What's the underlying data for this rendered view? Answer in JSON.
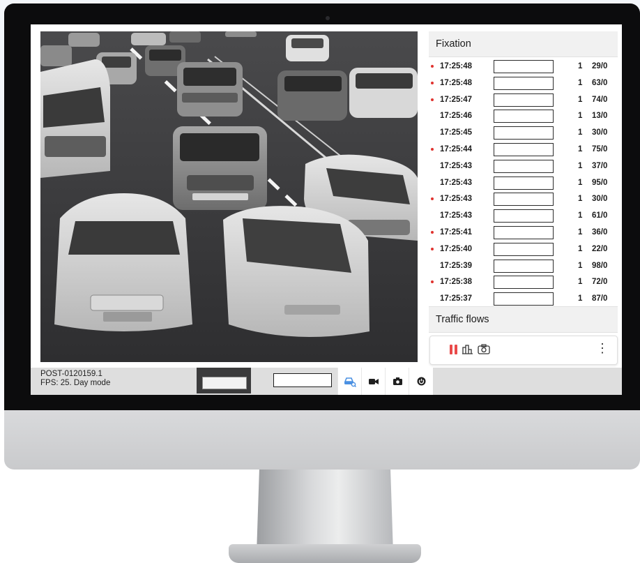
{
  "device": {
    "type": "desktop-monitor"
  },
  "fixation": {
    "title": "Fixation",
    "rows": [
      {
        "time": "17:25:48",
        "count": "1",
        "speed": "29/0",
        "flag": true
      },
      {
        "time": "17:25:48",
        "count": "1",
        "speed": "63/0",
        "flag": true
      },
      {
        "time": "17:25:47",
        "count": "1",
        "speed": "74/0",
        "flag": true
      },
      {
        "time": "17:25:46",
        "count": "1",
        "speed": "13/0",
        "flag": false
      },
      {
        "time": "17:25:45",
        "count": "1",
        "speed": "30/0",
        "flag": false
      },
      {
        "time": "17:25:44",
        "count": "1",
        "speed": "75/0",
        "flag": true
      },
      {
        "time": "17:25:43",
        "count": "1",
        "speed": "37/0",
        "flag": false
      },
      {
        "time": "17:25:43",
        "count": "1",
        "speed": "95/0",
        "flag": false
      },
      {
        "time": "17:25:43",
        "count": "1",
        "speed": "30/0",
        "flag": true
      },
      {
        "time": "17:25:43",
        "count": "1",
        "speed": "61/0",
        "flag": false
      },
      {
        "time": "17:25:41",
        "count": "1",
        "speed": "36/0",
        "flag": true
      },
      {
        "time": "17:25:40",
        "count": "1",
        "speed": "22/0",
        "flag": true
      },
      {
        "time": "17:25:39",
        "count": "1",
        "speed": "98/0",
        "flag": false
      },
      {
        "time": "17:25:38",
        "count": "1",
        "speed": "72/0",
        "flag": true
      },
      {
        "time": "17:25:37",
        "count": "1",
        "speed": "87/0",
        "flag": false
      }
    ]
  },
  "traffic_flows": {
    "title": "Traffic flows",
    "card": {
      "icons": [
        "pause-icon",
        "chart-icon",
        "camera-settings-icon"
      ],
      "menu_icon": "kebab-menu-icon"
    }
  },
  "status_bar": {
    "post_id": "POST-0120159.1",
    "fps_line": "FPS: 25. Day mode",
    "buttons": [
      "car-search-icon",
      "video-icon",
      "camera-icon",
      "power-icon"
    ]
  },
  "colors": {
    "accent": "#4a90e2",
    "flag": "#e0332f",
    "pause": "#e94a4a"
  }
}
